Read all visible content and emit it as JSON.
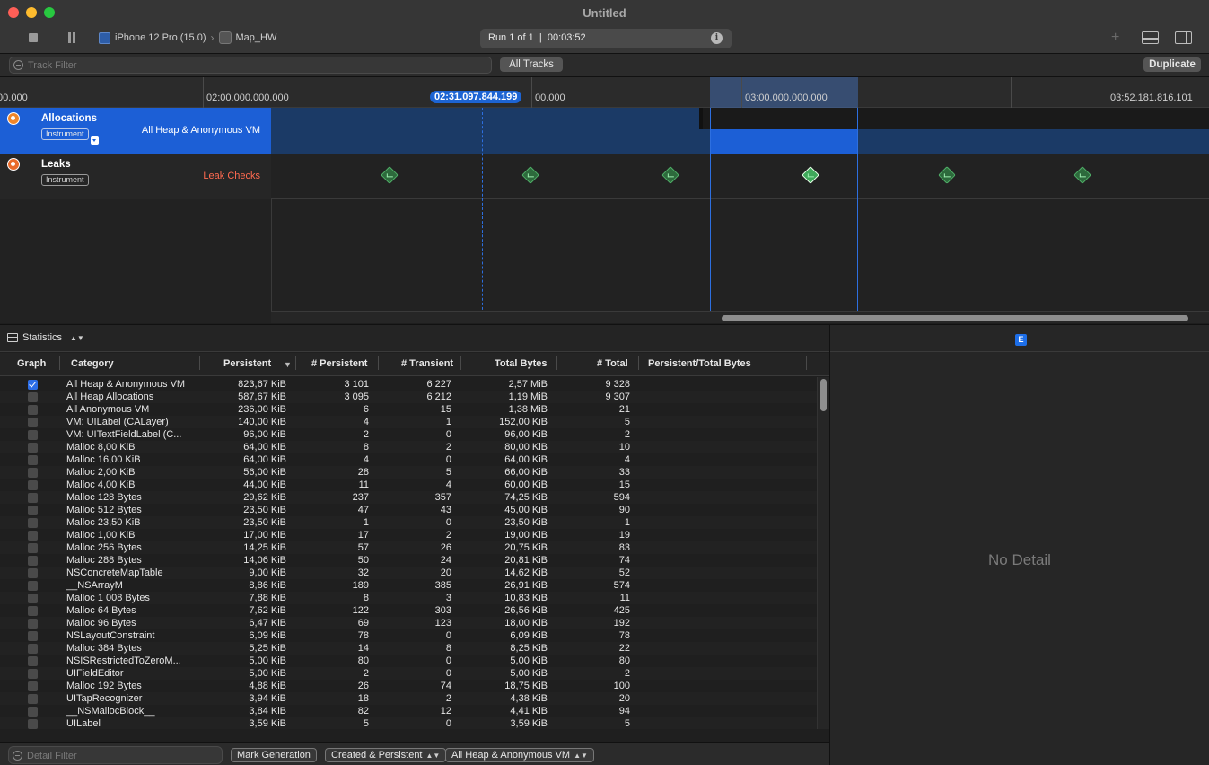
{
  "window": {
    "title": "Untitled",
    "device": "iPhone 12 Pro (15.0)",
    "app": "Map_HW",
    "run_status": "Run 1 of 1  |  00:03:52"
  },
  "filter_bar": {
    "track_filter_placeholder": "Track Filter",
    "all_tracks": "All Tracks",
    "duplicate": "Duplicate"
  },
  "ruler": {
    "labels": [
      ":00.000",
      "02:00.000.000.000",
      "00.000",
      "03:00.000.000.000",
      "03:52.181.816.101"
    ],
    "cursor_time": "02:31.097.844.199"
  },
  "tracks": [
    {
      "name": "Allocations",
      "badge": "Instrument",
      "detail": "All Heap & Anonymous VM"
    },
    {
      "name": "Leaks",
      "badge": "Instrument",
      "detail": "Leak Checks"
    }
  ],
  "statistics": {
    "label": "Statistics",
    "columns": [
      "Graph",
      "Category",
      "Persistent",
      "# Persistent",
      "# Transient",
      "Total Bytes",
      "# Total",
      "Persistent/Total Bytes"
    ],
    "rows": [
      {
        "graph": true,
        "category": "All Heap & Anonymous VM",
        "persistent": "823,67 KiB",
        "n_persistent": "3 101",
        "n_transient": "6 227",
        "total_bytes": "2,57 MiB",
        "n_total": "9 328"
      },
      {
        "graph": false,
        "category": "All Heap Allocations",
        "persistent": "587,67 KiB",
        "n_persistent": "3 095",
        "n_transient": "6 212",
        "total_bytes": "1,19 MiB",
        "n_total": "9 307"
      },
      {
        "graph": false,
        "category": "All Anonymous VM",
        "persistent": "236,00 KiB",
        "n_persistent": "6",
        "n_transient": "15",
        "total_bytes": "1,38 MiB",
        "n_total": "21"
      },
      {
        "graph": false,
        "category": "VM: UILabel (CALayer)",
        "persistent": "140,00 KiB",
        "n_persistent": "4",
        "n_transient": "1",
        "total_bytes": "152,00 KiB",
        "n_total": "5"
      },
      {
        "graph": false,
        "category": "VM: UITextFieldLabel (C...",
        "persistent": "96,00 KiB",
        "n_persistent": "2",
        "n_transient": "0",
        "total_bytes": "96,00 KiB",
        "n_total": "2"
      },
      {
        "graph": false,
        "category": "Malloc 8,00 KiB",
        "persistent": "64,00 KiB",
        "n_persistent": "8",
        "n_transient": "2",
        "total_bytes": "80,00 KiB",
        "n_total": "10"
      },
      {
        "graph": false,
        "category": "Malloc 16,00 KiB",
        "persistent": "64,00 KiB",
        "n_persistent": "4",
        "n_transient": "0",
        "total_bytes": "64,00 KiB",
        "n_total": "4"
      },
      {
        "graph": false,
        "category": "Malloc 2,00 KiB",
        "persistent": "56,00 KiB",
        "n_persistent": "28",
        "n_transient": "5",
        "total_bytes": "66,00 KiB",
        "n_total": "33"
      },
      {
        "graph": false,
        "category": "Malloc 4,00 KiB",
        "persistent": "44,00 KiB",
        "n_persistent": "11",
        "n_transient": "4",
        "total_bytes": "60,00 KiB",
        "n_total": "15"
      },
      {
        "graph": false,
        "category": "Malloc 128 Bytes",
        "persistent": "29,62 KiB",
        "n_persistent": "237",
        "n_transient": "357",
        "total_bytes": "74,25 KiB",
        "n_total": "594"
      },
      {
        "graph": false,
        "category": "Malloc 512 Bytes",
        "persistent": "23,50 KiB",
        "n_persistent": "47",
        "n_transient": "43",
        "total_bytes": "45,00 KiB",
        "n_total": "90"
      },
      {
        "graph": false,
        "category": "Malloc 23,50 KiB",
        "persistent": "23,50 KiB",
        "n_persistent": "1",
        "n_transient": "0",
        "total_bytes": "23,50 KiB",
        "n_total": "1"
      },
      {
        "graph": false,
        "category": "Malloc 1,00 KiB",
        "persistent": "17,00 KiB",
        "n_persistent": "17",
        "n_transient": "2",
        "total_bytes": "19,00 KiB",
        "n_total": "19"
      },
      {
        "graph": false,
        "category": "Malloc 256 Bytes",
        "persistent": "14,25 KiB",
        "n_persistent": "57",
        "n_transient": "26",
        "total_bytes": "20,75 KiB",
        "n_total": "83"
      },
      {
        "graph": false,
        "category": "Malloc 288 Bytes",
        "persistent": "14,06 KiB",
        "n_persistent": "50",
        "n_transient": "24",
        "total_bytes": "20,81 KiB",
        "n_total": "74"
      },
      {
        "graph": false,
        "category": "NSConcreteMapTable",
        "persistent": "9,00 KiB",
        "n_persistent": "32",
        "n_transient": "20",
        "total_bytes": "14,62 KiB",
        "n_total": "52"
      },
      {
        "graph": false,
        "category": "__NSArrayM",
        "persistent": "8,86 KiB",
        "n_persistent": "189",
        "n_transient": "385",
        "total_bytes": "26,91 KiB",
        "n_total": "574"
      },
      {
        "graph": false,
        "category": "Malloc 1 008 Bytes",
        "persistent": "7,88 KiB",
        "n_persistent": "8",
        "n_transient": "3",
        "total_bytes": "10,83 KiB",
        "n_total": "11"
      },
      {
        "graph": false,
        "category": "Malloc 64 Bytes",
        "persistent": "7,62 KiB",
        "n_persistent": "122",
        "n_transient": "303",
        "total_bytes": "26,56 KiB",
        "n_total": "425"
      },
      {
        "graph": false,
        "category": "Malloc 96 Bytes",
        "persistent": "6,47 KiB",
        "n_persistent": "69",
        "n_transient": "123",
        "total_bytes": "18,00 KiB",
        "n_total": "192"
      },
      {
        "graph": false,
        "category": "NSLayoutConstraint",
        "persistent": "6,09 KiB",
        "n_persistent": "78",
        "n_transient": "0",
        "total_bytes": "6,09 KiB",
        "n_total": "78"
      },
      {
        "graph": false,
        "category": "Malloc 384 Bytes",
        "persistent": "5,25 KiB",
        "n_persistent": "14",
        "n_transient": "8",
        "total_bytes": "8,25 KiB",
        "n_total": "22"
      },
      {
        "graph": false,
        "category": "NSISRestrictedToZeroM...",
        "persistent": "5,00 KiB",
        "n_persistent": "80",
        "n_transient": "0",
        "total_bytes": "5,00 KiB",
        "n_total": "80"
      },
      {
        "graph": false,
        "category": "UIFieldEditor",
        "persistent": "5,00 KiB",
        "n_persistent": "2",
        "n_transient": "0",
        "total_bytes": "5,00 KiB",
        "n_total": "2"
      },
      {
        "graph": false,
        "category": "Malloc 192 Bytes",
        "persistent": "4,88 KiB",
        "n_persistent": "26",
        "n_transient": "74",
        "total_bytes": "18,75 KiB",
        "n_total": "100"
      },
      {
        "graph": false,
        "category": "UITapRecognizer",
        "persistent": "3,94 KiB",
        "n_persistent": "18",
        "n_transient": "2",
        "total_bytes": "4,38 KiB",
        "n_total": "20"
      },
      {
        "graph": false,
        "category": "__NSMallocBlock__",
        "persistent": "3,84 KiB",
        "n_persistent": "82",
        "n_transient": "12",
        "total_bytes": "4,41 KiB",
        "n_total": "94"
      },
      {
        "graph": false,
        "category": "UILabel",
        "persistent": "3,59 KiB",
        "n_persistent": "5",
        "n_transient": "0",
        "total_bytes": "3,59 KiB",
        "n_total": "5"
      }
    ]
  },
  "bottom_bar": {
    "detail_filter_placeholder": "Detail Filter",
    "mark_generation": "Mark Generation",
    "lifespan": "Created & Persistent",
    "allocation_type": "All Heap & Anonymous VM"
  },
  "detail_pane": {
    "tab": "E",
    "empty_text": "No Detail"
  }
}
